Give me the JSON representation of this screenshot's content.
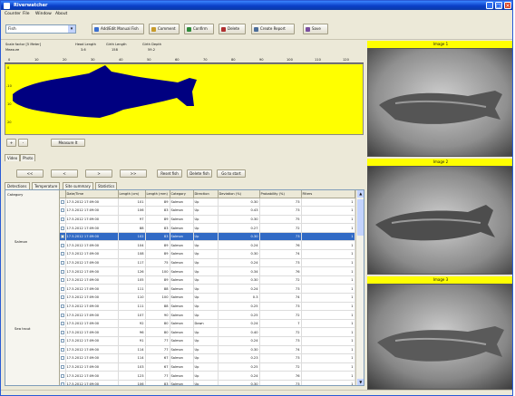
{
  "app": {
    "title": "Riverwatcher"
  },
  "window_controls": {
    "minimize": "_",
    "maximize": "□",
    "close": "×"
  },
  "menu": [
    "Counter",
    "File",
    "Window",
    "About"
  ],
  "toolbar": {
    "dropdown_value": "Fish",
    "buttons": [
      {
        "label": "Add/Edit Manual Fish",
        "icon": "fish-icon",
        "color": "#3a6fd0"
      },
      {
        "label": "Comment",
        "icon": "comment-icon",
        "color": "#c89b2a"
      },
      {
        "label": "Confirm",
        "icon": "confirm-icon",
        "color": "#2e8b3a"
      },
      {
        "label": "Delete",
        "icon": "delete-icon",
        "color": "#b03030"
      },
      {
        "label": "Create Report",
        "icon": "report-icon",
        "color": "#4b6d9a"
      },
      {
        "label": "Save",
        "icon": "save-icon",
        "color": "#7a4fa0"
      }
    ]
  },
  "ruler": {
    "labels": [
      "Scale factor [5 Meter]",
      "Head Length",
      "Girth Length",
      "Girth Depth"
    ],
    "values": [
      "Measure",
      "3.6",
      "158",
      "59.2"
    ],
    "ticks": [
      "0",
      "10",
      "20",
      "30",
      "40",
      "50",
      "60",
      "70",
      "80",
      "90",
      "100",
      "110",
      "120"
    ],
    "left_scale": [
      "0",
      "-10",
      "10",
      "20"
    ]
  },
  "fish_panel": {
    "bg_color": "#ffff00",
    "fish_color": "#000080"
  },
  "zoom": {
    "zoom_in": "+",
    "zoom_out": "-",
    "measure_label": "Measure It"
  },
  "nav": {
    "tabs": [
      "Video",
      "Photo"
    ],
    "buttons": [
      "<<",
      "<",
      ">",
      ">>"
    ],
    "actions": [
      "Reset fish",
      "Delete fish",
      "Go to start"
    ]
  },
  "data_tabs": [
    "Detections",
    "Temperature",
    "Site summary",
    "Statistics"
  ],
  "categories": [
    "Category",
    "Salmon",
    "Sea trout"
  ],
  "table": {
    "headers": [
      "",
      "Date/Time",
      "Length (cm)",
      "Length (mm)",
      "Category",
      "Direction",
      "Deviation (%)",
      "Probability (%)",
      "Filters"
    ],
    "rows": [
      [
        "",
        "17.5.2012 17:09:00",
        "101",
        "89",
        "Salmon",
        "Up",
        "0.30",
        "73",
        "1"
      ],
      [
        "",
        "17.5.2012 17:09:00",
        "106",
        "83",
        "Salmon",
        "Up",
        "0.43",
        "73",
        "1"
      ],
      [
        "",
        "17.5.2012 17:09:00",
        "97",
        "89",
        "Salmon",
        "Up",
        "0.30",
        "75",
        "1"
      ],
      [
        "",
        "17.5.2012 17:09:00",
        "88",
        "83",
        "Salmon",
        "Up",
        "0.27",
        "72",
        "1"
      ],
      [
        "",
        "17.5.2012 17:09:00",
        "102",
        "83",
        "Salmon",
        "Up",
        "0.30",
        "73",
        "1"
      ],
      [
        "",
        "17.5.2012 17:09:00",
        "104",
        "89",
        "Salmon",
        "Up",
        "0.24",
        "76",
        "1"
      ],
      [
        "",
        "17.5.2012 17:09:00",
        "108",
        "89",
        "Salmon",
        "Up",
        "0.30",
        "74",
        "1"
      ],
      [
        "",
        "17.5.2012 17:09:00",
        "117",
        "75",
        "Salmon",
        "Up",
        "0.24",
        "73",
        "1"
      ],
      [
        "",
        "17.5.2012 17:09:00",
        "126",
        "100",
        "Salmon",
        "Up",
        "0.34",
        "76",
        "1"
      ],
      [
        "",
        "17.5.2012 17:09:00",
        "105",
        "89",
        "Salmon",
        "Up",
        "0.30",
        "72",
        "1"
      ],
      [
        "",
        "17.5.2012 17:09:00",
        "111",
        "88",
        "Salmon",
        "Up",
        "0.24",
        "73",
        "1"
      ],
      [
        "",
        "17.5.2012 17:09:00",
        "110",
        "100",
        "Salmon",
        "Up",
        "0.3",
        "74",
        "1"
      ],
      [
        "",
        "17.5.2012 17:09:00",
        "111",
        "88",
        "Salmon",
        "Up",
        "0.25",
        "73",
        "1"
      ],
      [
        "",
        "17.5.2012 17:09:00",
        "107",
        "90",
        "Salmon",
        "Up",
        "0.25",
        "72",
        "1"
      ],
      [
        "",
        "17.5.2012 17:09:00",
        "92",
        "80",
        "Salmon",
        "Down",
        "0.24",
        "7",
        "1"
      ],
      [
        "",
        "17.5.2012 17:09:00",
        "96",
        "80",
        "Salmon",
        "Up",
        "0.40",
        "72",
        "1"
      ],
      [
        "",
        "17.5.2012 17:09:00",
        "91",
        "77",
        "Salmon",
        "Up",
        "0.24",
        "73",
        "1"
      ],
      [
        "",
        "17.5.2012 17:09:00",
        "114",
        "77",
        "Salmon",
        "Up",
        "0.30",
        "74",
        "1"
      ],
      [
        "",
        "17.5.2012 17:09:00",
        "114",
        "67",
        "Salmon",
        "Up",
        "0.23",
        "73",
        "1"
      ],
      [
        "",
        "17.5.2012 17:09:00",
        "103",
        "67",
        "Salmon",
        "Up",
        "0.25",
        "72",
        "1"
      ],
      [
        "",
        "17.5.2012 17:09:00",
        "123",
        "77",
        "Salmon",
        "Up",
        "0.24",
        "76",
        "1"
      ],
      [
        "",
        "17.5.2012 17:09:00",
        "106",
        "83",
        "Salmon",
        "Up",
        "0.30",
        "73",
        "1"
      ],
      [
        "",
        "17.5.2012 17:09:00",
        "101",
        "83",
        "Salmon",
        "Up",
        "0.3",
        "74",
        "1"
      ]
    ],
    "selected_index": 4
  },
  "cameras": [
    {
      "title": "Image 1"
    },
    {
      "title": "Image 2"
    },
    {
      "title": "Image 3"
    }
  ]
}
